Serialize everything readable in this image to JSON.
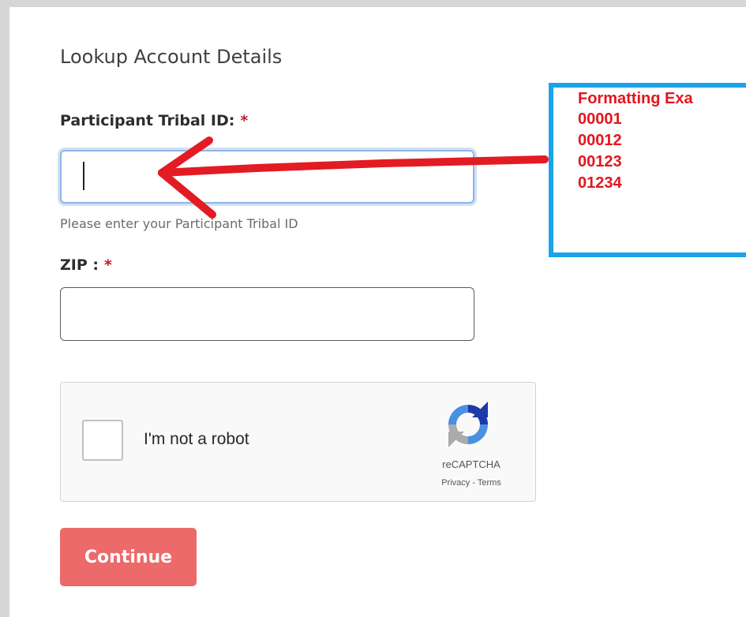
{
  "form": {
    "heading": "Lookup Account Details",
    "tribal_id_label": "Participant Tribal ID:",
    "tribal_id_value": "",
    "required_mark": "*",
    "tribal_id_help": "Please enter your Participant Tribal ID",
    "zip_label": "ZIP :",
    "zip_value": "",
    "continue_label": "Continue"
  },
  "captcha": {
    "label": "I'm not a robot",
    "brand": "reCAPTCHA",
    "privacy": "Privacy",
    "separator": " - ",
    "terms": "Terms"
  },
  "annotation": {
    "lines": [
      "Formatting Exa",
      "00001",
      "00012",
      "00123",
      "01234"
    ],
    "color": "#e3161d",
    "border_color": "#1aa3e8"
  },
  "colors": {
    "button": "#ec6a6a",
    "required": "#c4192b",
    "focus_border": "#8fb5e6"
  },
  "icons": {
    "captcha_logo": "recaptcha-logo-icon",
    "arrow": "red-arrow-annotation"
  }
}
